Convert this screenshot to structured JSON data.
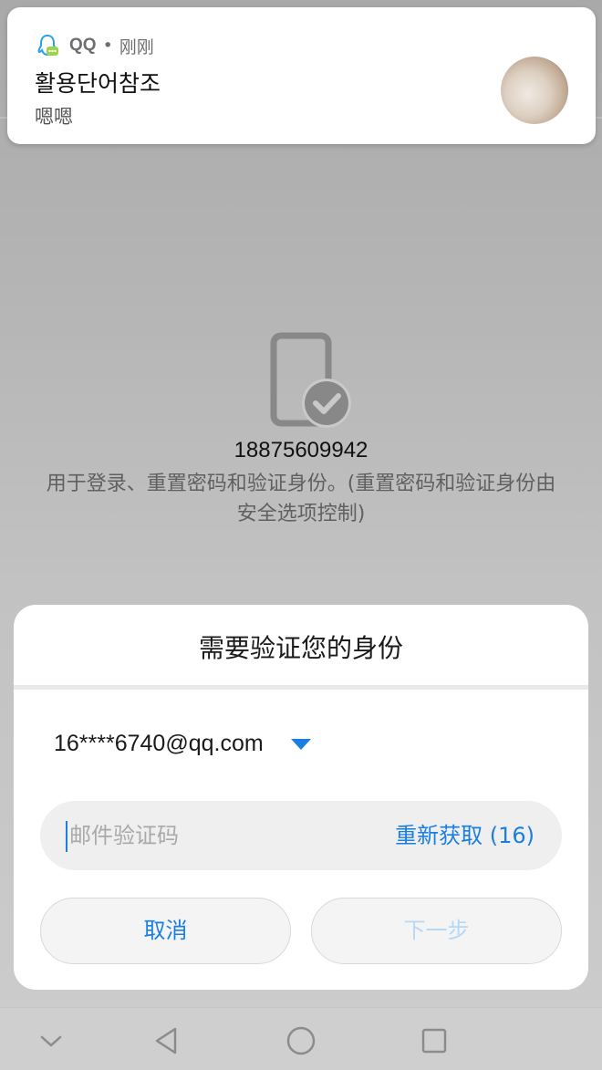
{
  "notification": {
    "app_name": "QQ",
    "separator": "•",
    "time": "刚刚",
    "title": "활용단어참조",
    "body": "嗯嗯"
  },
  "verification": {
    "phone_number": "18875609942",
    "description": "用于登录、重置密码和验证身份。(重置密码和验证身份由安全选项控制)"
  },
  "dialog": {
    "title": "需要验证您的身份",
    "email": "16****6740@qq.com",
    "code_placeholder": "邮件验证码",
    "code_value": "",
    "resend_label": "重新获取 (16)",
    "cancel_label": "取消",
    "next_label": "下一步"
  },
  "navbar": {
    "items": [
      "chevron-down-icon",
      "back-triangle-icon",
      "home-circle-icon",
      "recents-square-icon"
    ]
  },
  "colors": {
    "accent": "#1a7fe0",
    "disabled_accent": "#b8d7f5",
    "qq_icon": "#2aa2ea"
  }
}
